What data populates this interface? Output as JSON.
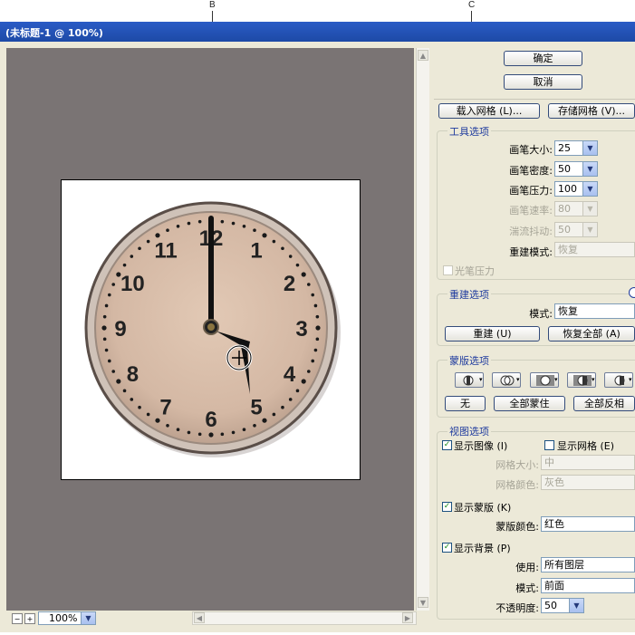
{
  "callouts": [
    "B",
    "C"
  ],
  "window": {
    "title": "(未标题-1 @ 100%)"
  },
  "zoom": {
    "value": "100%",
    "minus": "−",
    "plus": "+"
  },
  "clock": {
    "numerals": [
      "12",
      "1",
      "2",
      "3",
      "4",
      "5",
      "6",
      "7",
      "8",
      "9",
      "10",
      "11"
    ]
  },
  "buttons": {
    "ok": "确定",
    "cancel": "取消",
    "load_mesh": "载入网格 (L)...",
    "save_mesh": "存储网格 (V)..."
  },
  "tool_options": {
    "legend": "工具选项",
    "brush_size": {
      "label": "画笔大小:",
      "value": "25"
    },
    "brush_density": {
      "label": "画笔密度:",
      "value": "50"
    },
    "brush_pressure": {
      "label": "画笔压力:",
      "value": "100"
    },
    "brush_rate": {
      "label": "画笔速率:",
      "value": "80"
    },
    "turbulent_jitter": {
      "label": "湍流抖动:",
      "value": "50"
    },
    "reconstruct_mode": {
      "label": "重建模式:",
      "value": "恢复"
    },
    "stylus_pressure": "光笔压力"
  },
  "reconstruct_options": {
    "legend": "重建选项",
    "mode": {
      "label": "模式:",
      "value": "恢复"
    },
    "reconstruct_btn": "重建 (U)",
    "restore_all_btn": "恢复全部 (A)"
  },
  "mask_options": {
    "legend": "蒙版选项",
    "none_btn": "无",
    "mask_all_btn": "全部蒙住",
    "invert_all_btn": "全部反相"
  },
  "view_options": {
    "legend": "视图选项",
    "show_image": "显示图像 (I)",
    "show_mesh": "显示网格 (E)",
    "mesh_size": {
      "label": "网格大小:",
      "value": "中"
    },
    "mesh_color": {
      "label": "网格颜色:",
      "value": "灰色"
    },
    "show_mask": "显示蒙版 (K)",
    "mask_color": {
      "label": "蒙版颜色:",
      "value": "红色"
    },
    "show_backdrop": "显示背景 (P)",
    "use": {
      "label": "使用:",
      "value": "所有图层"
    },
    "mode": {
      "label": "模式:",
      "value": "前面"
    },
    "opacity": {
      "label": "不透明度:",
      "value": "50"
    }
  }
}
